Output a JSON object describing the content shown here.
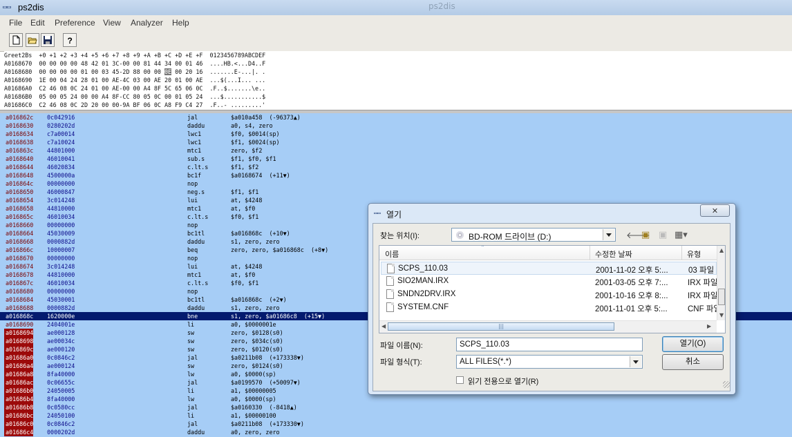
{
  "app": {
    "title": "ps2dis",
    "title_icon": "ps2dis-app-icon",
    "ghost_title": "ps2dis"
  },
  "menu": [
    "File",
    "Edit",
    "Preference",
    "View",
    "Analyzer",
    "Help"
  ],
  "toolbar": {
    "buttons": [
      "new-file-icon",
      "open-folder-icon",
      "save-disk-icon",
      "help-question-icon"
    ],
    "help_glyph": "?"
  },
  "hexdump": {
    "header": "Greet2Bs  +0 +1 +2 +3 +4 +5 +6 +7 +8 +9 +A +B +C +D +E +F  0123456789ABCDEF",
    "rows": [
      {
        "pre": "A0168670  00 00 00 00 48 42 01 3C-00 00 81 44 34 00 01 46  ....HB.<...D4..F",
        "hl": "",
        "post": ""
      },
      {
        "pre": "A0168680  00 00 00 00 01 00 03 45-2D 88 00 00 ",
        "hl": "0E",
        "post": " 00 20 16  .......E-...|. ."
      },
      {
        "pre": "A0168690  1E 00 04 24 28 01 00 AE-4C 03 00 AE 20 01 00 AE  ...$(...I... ...",
        "hl": "",
        "post": ""
      },
      {
        "pre": "A01686A0  C2 46 08 0C 24 01 00 AE-00 00 A4 8F 5C 65 06 0C  .F..$.......\\e..",
        "hl": "",
        "post": ""
      },
      {
        "pre": "A01686B0  05 00 05 24 00 00 A4 8F-CC 80 05 0C 00 01 05 24  ...$...........$",
        "hl": "",
        "post": ""
      },
      {
        "pre": "A01686C0  C2 46 08 0C 2D 20 00 00-9A BF 06 0C A8 F9 C4 27  .F..- .........'",
        "hl": "",
        "post": ""
      }
    ]
  },
  "disasm": {
    "selected_index": 24,
    "rows": [
      {
        "addr": "a016862c",
        "hex": "0c042916",
        "mn": "jal",
        "op": "$a010a458  (-96373▲)",
        "mark": false
      },
      {
        "addr": "a0168630",
        "hex": "0280202d",
        "mn": "daddu",
        "op": "a0, s4, zero",
        "mark": false
      },
      {
        "addr": "a0168634",
        "hex": "c7a00014",
        "mn": "lwc1",
        "op": "$f0, $0014(sp)",
        "mark": false
      },
      {
        "addr": "a0168638",
        "hex": "c7a10024",
        "mn": "lwc1",
        "op": "$f1, $0024(sp)",
        "mark": false
      },
      {
        "addr": "a016863c",
        "hex": "44801000",
        "mn": "mtc1",
        "op": "zero, $f2",
        "mark": false
      },
      {
        "addr": "a0168640",
        "hex": "46010041",
        "mn": "sub.s",
        "op": "$f1, $f0, $f1",
        "mark": false
      },
      {
        "addr": "a0168644",
        "hex": "46020834",
        "mn": "c.lt.s",
        "op": "$f1, $f2",
        "mark": false
      },
      {
        "addr": "a0168648",
        "hex": "4500000a",
        "mn": "bc1f",
        "op": "$a0168674  (+11▼)",
        "mark": false
      },
      {
        "addr": "a016864c",
        "hex": "00000000",
        "mn": "nop",
        "op": "",
        "mark": false
      },
      {
        "addr": "a0168650",
        "hex": "46000847",
        "mn": "neg.s",
        "op": "$f1, $f1",
        "mark": false
      },
      {
        "addr": "a0168654",
        "hex": "3c014248",
        "mn": "lui",
        "op": "at, $4248",
        "mark": false
      },
      {
        "addr": "a0168658",
        "hex": "44810000",
        "mn": "mtc1",
        "op": "at, $f0",
        "mark": false
      },
      {
        "addr": "a016865c",
        "hex": "46010034",
        "mn": "c.lt.s",
        "op": "$f0, $f1",
        "mark": false
      },
      {
        "addr": "a0168660",
        "hex": "00000000",
        "mn": "nop",
        "op": "",
        "mark": false
      },
      {
        "addr": "a0168664",
        "hex": "45030009",
        "mn": "bc1tl",
        "op": "$a016868c  (+10▼)",
        "mark": false
      },
      {
        "addr": "a0168668",
        "hex": "0000882d",
        "mn": "daddu",
        "op": "s1, zero, zero",
        "mark": false
      },
      {
        "addr": "a016866c",
        "hex": "10000007",
        "mn": "beq",
        "op": "zero, zero, $a016868c  (+8▼)",
        "mark": false
      },
      {
        "addr": "a0168670",
        "hex": "00000000",
        "mn": "nop",
        "op": "",
        "mark": false
      },
      {
        "addr": "a0168674",
        "hex": "3c014248",
        "mn": "lui",
        "op": "at, $4248",
        "mark": false
      },
      {
        "addr": "a0168678",
        "hex": "44810000",
        "mn": "mtc1",
        "op": "at, $f0",
        "mark": false
      },
      {
        "addr": "a016867c",
        "hex": "46010034",
        "mn": "c.lt.s",
        "op": "$f0, $f1",
        "mark": false
      },
      {
        "addr": "a0168680",
        "hex": "00000000",
        "mn": "nop",
        "op": "",
        "mark": false
      },
      {
        "addr": "a0168684",
        "hex": "45030001",
        "mn": "bc1tl",
        "op": "$a016868c  (+2▼)",
        "mark": false
      },
      {
        "addr": "a0168688",
        "hex": "0000882d",
        "mn": "daddu",
        "op": "s1, zero, zero",
        "mark": false
      },
      {
        "addr": "a016868c",
        "hex": "1620000e",
        "mn": "bne",
        "op": "s1, zero, $a01686c8  (+15▼)",
        "mark": false
      },
      {
        "addr": "a0168690",
        "hex": "2404001e",
        "mn": "li",
        "op": "a0, $0000001e",
        "mark": false
      },
      {
        "addr": "a0168694",
        "hex": "ae000128",
        "mn": "sw",
        "op": "zero, $0128(s0)",
        "mark": true
      },
      {
        "addr": "a0168698",
        "hex": "ae00034c",
        "mn": "sw",
        "op": "zero, $034c(s0)",
        "mark": true
      },
      {
        "addr": "a016869c",
        "hex": "ae000120",
        "mn": "sw",
        "op": "zero, $0120(s0)",
        "mark": true
      },
      {
        "addr": "a01686a0",
        "hex": "0c0846c2",
        "mn": "jal",
        "op": "$a0211b08  (+173338▼)",
        "mark": true
      },
      {
        "addr": "a01686a4",
        "hex": "ae000124",
        "mn": "sw",
        "op": "zero, $0124(s0)",
        "mark": true
      },
      {
        "addr": "a01686a8",
        "hex": "8fa40000",
        "mn": "lw",
        "op": "a0, $0000(sp)",
        "mark": true
      },
      {
        "addr": "a01686ac",
        "hex": "0c06655c",
        "mn": "jal",
        "op": "$a0199570  (+50097▼)",
        "mark": true
      },
      {
        "addr": "a01686b0",
        "hex": "24050005",
        "mn": "li",
        "op": "a1, $00000005",
        "mark": true
      },
      {
        "addr": "a01686b4",
        "hex": "8fa40000",
        "mn": "lw",
        "op": "a0, $0000(sp)",
        "mark": true
      },
      {
        "addr": "a01686b8",
        "hex": "0c0580cc",
        "mn": "jal",
        "op": "$a0160330  (-8418▲)",
        "mark": true
      },
      {
        "addr": "a01686bc",
        "hex": "24050100",
        "mn": "li",
        "op": "a1, $00000100",
        "mark": true
      },
      {
        "addr": "a01686c0",
        "hex": "0c0846c2",
        "mn": "jal",
        "op": "$a0211b08  (+173330▼)",
        "mark": true
      },
      {
        "addr": "a01686c4",
        "hex": "0000202d",
        "mn": "daddu",
        "op": "a0, zero, zero",
        "mark": true
      }
    ]
  },
  "dialog": {
    "title": "열기",
    "close_label": "✕",
    "lookin_label": "찾는 위치(I):",
    "lookin_value": "BD-ROM 드라이브 (D:)",
    "nav_icons": [
      "back-arrow-icon",
      "up-folder-icon",
      "new-folder-icon",
      "view-menu-icon"
    ],
    "columns": [
      "이름",
      "수정한 날짜",
      "유형"
    ],
    "files": [
      {
        "name": "SCPS_110.03",
        "date": "2001-11-02 오후 5:...",
        "type": "03 파일"
      },
      {
        "name": "SIO2MAN.IRX",
        "date": "2001-03-05 오후 7:...",
        "type": "IRX 파일"
      },
      {
        "name": "SNDN2DRV.IRX",
        "date": "2001-10-16 오후 8:...",
        "type": "IRX 파일"
      },
      {
        "name": "SYSTEM.CNF",
        "date": "2001-11-01 오후 5:...",
        "type": "CNF 파일"
      }
    ],
    "filename_label": "파일 이름(N):",
    "filename_value": "SCPS_110.03",
    "filetype_label": "파일 형식(T):",
    "filetype_value": "ALL FILES(*.*)",
    "readonly_label": "읽기 전용으로 열기(R)",
    "open_button": "열기(O)",
    "cancel_button": "취소"
  }
}
